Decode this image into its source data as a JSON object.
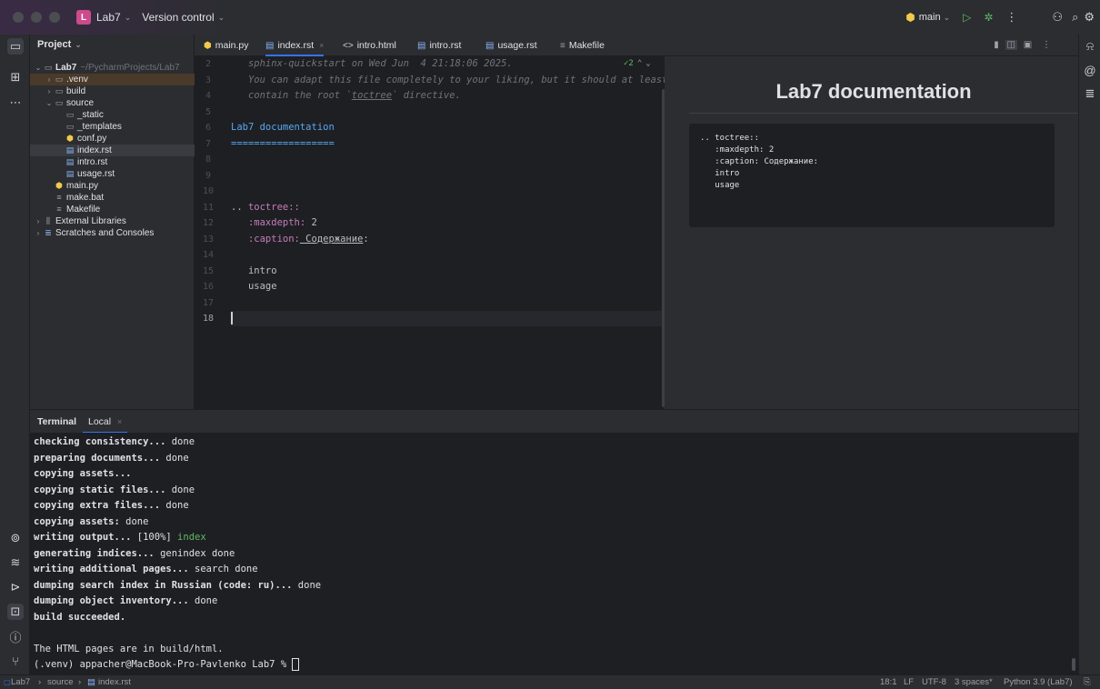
{
  "titlebar": {
    "project_badge": "L",
    "project_name": "Lab7",
    "vcs_label": "Version control",
    "branch": "main",
    "colors": {
      "badge": "#cc4b8c",
      "accent": "#3574f0",
      "run_green": "#5fb865"
    }
  },
  "project_panel": {
    "title": "Project",
    "tree": [
      {
        "label": "Lab7",
        "suffix": "~/PycharmProjects/Lab7",
        "icon": "folder-icon",
        "depth": 0,
        "expanded": "⌄"
      },
      {
        "label": ".venv",
        "icon": "folder-icon",
        "depth": 1,
        "expanded": "›"
      },
      {
        "label": "build",
        "icon": "folder-icon",
        "depth": 1,
        "expanded": "›"
      },
      {
        "label": "source",
        "icon": "folder-icon",
        "depth": 1,
        "expanded": "⌄"
      },
      {
        "label": "_static",
        "icon": "folder-icon",
        "depth": 2
      },
      {
        "label": "_templates",
        "icon": "folder-icon",
        "depth": 2
      },
      {
        "label": "conf.py",
        "icon": "python-file-icon",
        "depth": 2
      },
      {
        "label": "index.rst",
        "icon": "rst-file-icon",
        "depth": 2
      },
      {
        "label": "intro.rst",
        "icon": "rst-file-icon",
        "depth": 2
      },
      {
        "label": "usage.rst",
        "icon": "rst-file-icon",
        "depth": 2
      },
      {
        "label": "main.py",
        "icon": "python-file-icon",
        "depth": 1
      },
      {
        "label": "make.bat",
        "icon": "text-file-icon",
        "depth": 1
      },
      {
        "label": "Makefile",
        "icon": "text-file-icon",
        "depth": 1
      },
      {
        "label": "External Libraries",
        "icon": "library-icon",
        "depth": 0,
        "expanded": "›"
      },
      {
        "label": "Scratches and Consoles",
        "icon": "scratches-icon",
        "depth": 0,
        "expanded": "›"
      }
    ]
  },
  "tabs": [
    {
      "label": "main.py",
      "icon": "python-file-icon"
    },
    {
      "label": "index.rst",
      "icon": "rst-file-icon",
      "active": true
    },
    {
      "label": "intro.html",
      "icon": "html-file-icon"
    },
    {
      "label": "intro.rst",
      "icon": "rst-file-icon"
    },
    {
      "label": "usage.rst",
      "icon": "rst-file-icon"
    },
    {
      "label": "Makefile",
      "icon": "text-file-icon"
    }
  ],
  "editor": {
    "inspection": "✓2",
    "line_numbers": [
      "2",
      "3",
      "4",
      "5",
      "6",
      "7",
      "8",
      "9",
      "10",
      "11",
      "12",
      "13",
      "14",
      "15",
      "16",
      "17",
      "18"
    ],
    "lines": {
      "l2": "   sphinx-quickstart on Wed Jun  4 21:18:06 2025.",
      "l3": "   You can adapt this file completely to your liking, but it should at least",
      "l4a": "   contain the root `",
      "l4b": "toctree",
      "l4c": "` directive.",
      "l6": "Lab7 documentation",
      "l7": "==================",
      "l11a": ".. ",
      "l11b": "toctree::",
      "l12a": "   :maxdepth:",
      "l12b": " 2",
      "l13a": "   :caption:",
      "l13b": " Содержание",
      "l13c": ":",
      "l15": "   intro",
      "l16": "   usage"
    }
  },
  "preview": {
    "title": "Lab7 documentation",
    "code_lines": [
      ".. toctree::",
      "   :maxdepth: 2",
      "   :caption: Содержание:",
      "",
      "   intro",
      "   usage"
    ]
  },
  "terminal": {
    "tab_title": "Terminal",
    "session_tab": "Local",
    "lines": [
      {
        "bold": "checking consistency...",
        "rest": " done"
      },
      {
        "bold": "preparing documents...",
        "rest": " done"
      },
      {
        "bold": "copying assets...",
        "rest": ""
      },
      {
        "bold": "copying static files...",
        "rest": " done"
      },
      {
        "bold": "copying extra files...",
        "rest": " done"
      },
      {
        "bold": "copying assets:",
        "rest": " done"
      },
      {
        "bold": "writing output...",
        "rest": " [100%] ",
        "green": "index"
      },
      {
        "bold": "generating indices...",
        "rest": " genindex done"
      },
      {
        "bold": "writing additional pages...",
        "rest": " search done"
      },
      {
        "bold": "dumping search index in Russian (code: ru)...",
        "rest": " done"
      },
      {
        "bold": "dumping object inventory...",
        "rest": " done"
      },
      {
        "bold": "build succeeded.",
        "rest": ""
      },
      {
        "bold": "",
        "rest": ""
      },
      {
        "bold": "",
        "rest": "The HTML pages are in build/html."
      },
      {
        "bold": "",
        "rest": "(.venv) appacher@MacBook-Pro-Pavlenko Lab7 % "
      }
    ]
  },
  "statusbar": {
    "crumb_project": "Lab7",
    "crumb_folder": "source",
    "crumb_file": "index.rst",
    "position": "18:1",
    "line_sep": "LF",
    "encoding": "UTF-8",
    "indent": "3 spaces*",
    "interpreter": "Python 3.9 (Lab7)"
  }
}
